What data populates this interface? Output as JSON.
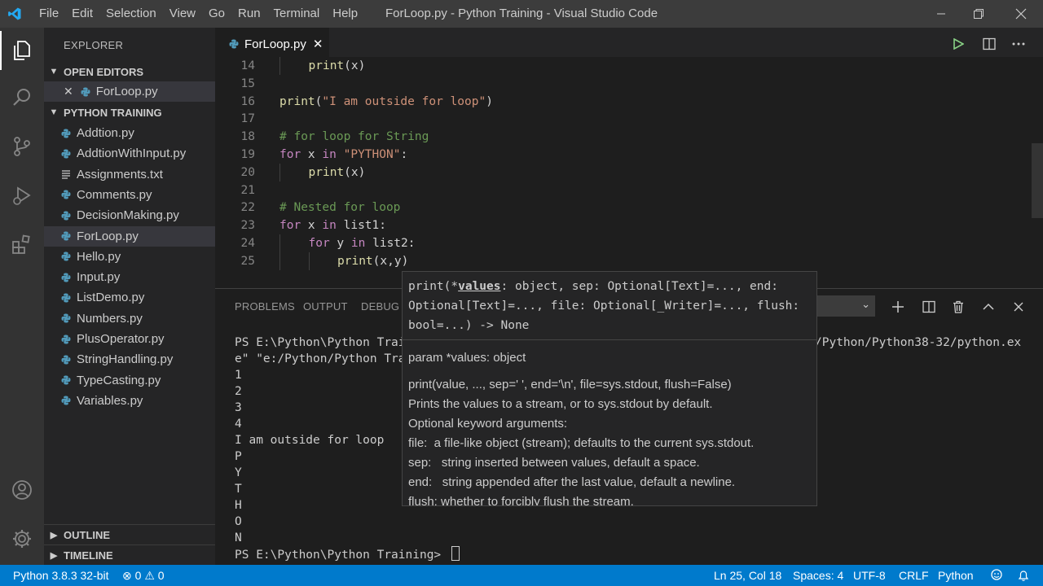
{
  "titlebar": {
    "menus": [
      "File",
      "Edit",
      "Selection",
      "View",
      "Go",
      "Run",
      "Terminal",
      "Help"
    ],
    "title": "ForLoop.py - Python Training - Visual Studio Code"
  },
  "sidebar": {
    "title": "EXPLORER",
    "open_editors_label": "OPEN EDITORS",
    "open_editor_file": "ForLoop.py",
    "project_label": "PYTHON TRAINING",
    "files": [
      "Addtion.py",
      "AddtionWithInput.py",
      "Assignments.txt",
      "Comments.py",
      "DecisionMaking.py",
      "ForLoop.py",
      "Hello.py",
      "Input.py",
      "ListDemo.py",
      "Numbers.py",
      "PlusOperator.py",
      "StringHandling.py",
      "TypeCasting.py",
      "Variables.py"
    ],
    "active_file": "ForLoop.py",
    "outline_label": "OUTLINE",
    "timeline_label": "TIMELINE"
  },
  "editor": {
    "tab_label": "ForLoop.py",
    "lines": [
      {
        "n": "14",
        "indent": 1,
        "tokens": [
          [
            "fn",
            "print"
          ],
          [
            "p",
            "(x)"
          ]
        ]
      },
      {
        "n": "15",
        "indent": 0,
        "tokens": []
      },
      {
        "n": "16",
        "indent": 0,
        "tokens": [
          [
            "fn",
            "print"
          ],
          [
            "p",
            "("
          ],
          [
            "str",
            "\"I am outside for loop\""
          ],
          [
            "p",
            ")"
          ]
        ]
      },
      {
        "n": "17",
        "indent": 0,
        "tokens": []
      },
      {
        "n": "18",
        "indent": 0,
        "tokens": [
          [
            "cm",
            "# for loop for String"
          ]
        ]
      },
      {
        "n": "19",
        "indent": 0,
        "tokens": [
          [
            "kw",
            "for"
          ],
          [
            "p",
            " x "
          ],
          [
            "kw",
            "in"
          ],
          [
            "p",
            " "
          ],
          [
            "str",
            "\"PYTHON\""
          ],
          [
            "p",
            ":"
          ]
        ]
      },
      {
        "n": "20",
        "indent": 1,
        "tokens": [
          [
            "fn",
            "print"
          ],
          [
            "p",
            "(x)"
          ]
        ]
      },
      {
        "n": "21",
        "indent": 0,
        "tokens": []
      },
      {
        "n": "22",
        "indent": 0,
        "tokens": [
          [
            "cm",
            "# Nested for loop"
          ]
        ]
      },
      {
        "n": "23",
        "indent": 0,
        "tokens": [
          [
            "kw",
            "for"
          ],
          [
            "p",
            " x "
          ],
          [
            "kw",
            "in"
          ],
          [
            "p",
            " list1:"
          ]
        ]
      },
      {
        "n": "24",
        "indent": 1,
        "tokens": [
          [
            "kw",
            "for"
          ],
          [
            "p",
            " y "
          ],
          [
            "kw",
            "in"
          ],
          [
            "p",
            " list2:"
          ]
        ]
      },
      {
        "n": "25",
        "indent": 2,
        "tokens": [
          [
            "fn",
            "print"
          ],
          [
            "p",
            "(x,y)"
          ]
        ]
      }
    ]
  },
  "panel": {
    "tabs": [
      "PROBLEMS",
      "OUTPUT",
      "DEBUG C"
    ],
    "terminal_lines": [
      "PS E:\\Python\\Python Trai",
      "e\" \"e:/Python/Python Tra",
      "1",
      "2",
      "3",
      "4",
      "I am outside for loop",
      "P",
      "Y",
      "T",
      "H",
      "O",
      "N",
      "PS E:\\Python\\Python Training> "
    ],
    "terminal_right_fragment": "/Python/Python38-32/python.ex"
  },
  "hover": {
    "sig_prefix": "print(*",
    "sig_param": "values",
    "sig_rest_line1": ": object, sep: Optional[Text]=..., end:",
    "sig_line2": "Optional[Text]=..., file: Optional[_Writer]=..., flush:",
    "sig_line3": "bool=...) -> None",
    "param": "param *values: object",
    "doc_lines": [
      "print(value, ..., sep=' ', end='\\n', file=sys.stdout, flush=False)",
      "Prints the values to a stream, or to sys.stdout by default.",
      "Optional keyword arguments:",
      "file:  a file-like object (stream); defaults to the current sys.stdout.",
      "sep:   string inserted between values, default a space.",
      "end:   string appended after the last value, default a newline.",
      "flush: whether to forcibly flush the stream."
    ]
  },
  "statusbar": {
    "interpreter": "Python 3.8.3 32-bit",
    "errors": "0",
    "warnings": "0",
    "position": "Ln 25, Col 18",
    "spaces": "Spaces: 4",
    "encoding": "UTF-8",
    "eol": "CRLF",
    "language": "Python"
  },
  "colors": {
    "accent": "#007acc",
    "python_icon": "#519aba"
  }
}
